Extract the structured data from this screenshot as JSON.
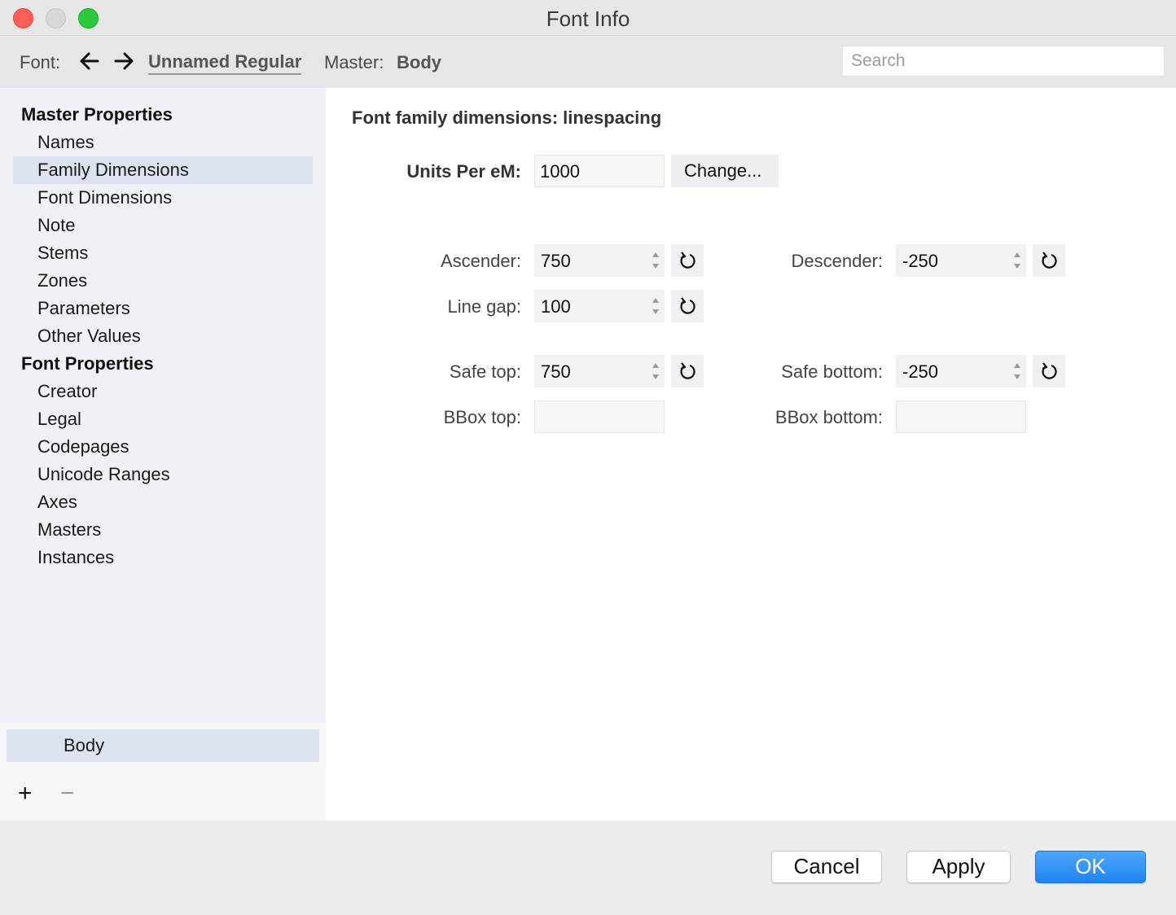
{
  "window": {
    "title": "Font Info"
  },
  "toolbar": {
    "font_label": "Font:",
    "back_icon": "arrow-left-icon",
    "forward_icon": "arrow-right-icon",
    "font_name": "Unnamed Regular",
    "master_label": "Master:",
    "master_value": "Body",
    "search_placeholder": "Search"
  },
  "sidebar": {
    "master_properties_heading": "Master Properties",
    "master_items": [
      "Names",
      "Family Dimensions",
      "Font Dimensions",
      "Note",
      "Stems",
      "Zones",
      "Parameters",
      "Other Values"
    ],
    "selected_item": "Family Dimensions",
    "font_properties_heading": "Font Properties",
    "font_items": [
      "Creator",
      "Legal",
      "Codepages",
      "Unicode Ranges",
      "Axes",
      "Masters",
      "Instances"
    ],
    "masters_list": [
      "Body"
    ],
    "add_label": "+",
    "remove_label": "−"
  },
  "main": {
    "section_title": "Font family dimensions: linespacing",
    "upm": {
      "label": "Units Per eM:",
      "value": "1000",
      "change_label": "Change..."
    },
    "ascender": {
      "label": "Ascender:",
      "value": "750"
    },
    "descender": {
      "label": "Descender:",
      "value": "-250"
    },
    "line_gap": {
      "label": "Line gap:",
      "value": "100"
    },
    "safe_top": {
      "label": "Safe top:",
      "value": "750"
    },
    "safe_bottom": {
      "label": "Safe bottom:",
      "value": "-250"
    },
    "bbox_top": {
      "label": "BBox top:",
      "value": ""
    },
    "bbox_bottom": {
      "label": "BBox bottom:",
      "value": ""
    }
  },
  "buttons": {
    "cancel": "Cancel",
    "apply": "Apply",
    "ok": "OK"
  },
  "colors": {
    "accent": "#1f84f1",
    "selection": "#dde2f1",
    "close": "#fc5f57",
    "maximize": "#2bc840"
  }
}
